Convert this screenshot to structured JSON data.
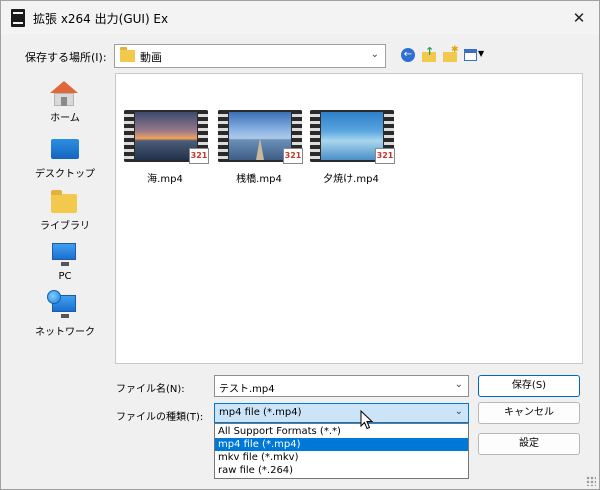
{
  "window": {
    "title": "拡張 x264 出力(GUI) Ex"
  },
  "location": {
    "label": "保存する場所(I):",
    "current": "動画"
  },
  "toolbar": {
    "icons": [
      "back-icon",
      "up-folder-icon",
      "new-folder-icon",
      "view-menu-icon"
    ]
  },
  "places": [
    {
      "label": "ホーム",
      "icon": "home-icon"
    },
    {
      "label": "デスクトップ",
      "icon": "desktop-icon"
    },
    {
      "label": "ライブラリ",
      "icon": "library-folder-icon"
    },
    {
      "label": "PC",
      "icon": "pc-icon"
    },
    {
      "label": "ネットワーク",
      "icon": "network-icon"
    }
  ],
  "files": [
    {
      "name": "海.mp4",
      "badge": "321"
    },
    {
      "name": "桟橋.mp4",
      "badge": "321"
    },
    {
      "name": "夕焼け.mp4",
      "badge": "321"
    }
  ],
  "form": {
    "filename_label": "ファイル名(N):",
    "filename_value": "テスト.mp4",
    "filetype_label": "ファイルの種類(T):",
    "filetype_value": "mp4 file (*.mp4)",
    "filetype_options": [
      "All Support Formats (*.*)",
      "mp4 file (*.mp4)",
      "mkv file (*.mkv)",
      "raw file (*.264)"
    ],
    "selected_option_index": 1
  },
  "buttons": {
    "save": "保存(S)",
    "cancel": "キャンセル",
    "settings": "設定"
  },
  "colors": {
    "accent": "#0078d7",
    "selection": "#0078d7",
    "combo_focus": "#cce4f7"
  }
}
